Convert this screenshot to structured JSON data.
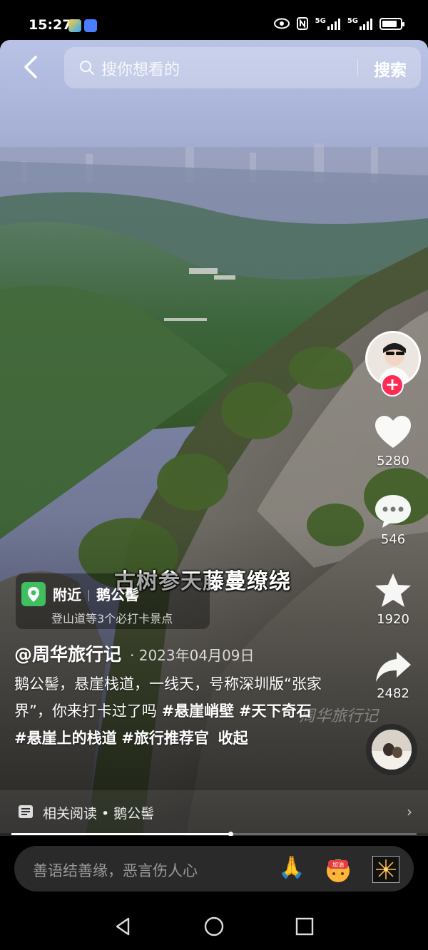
{
  "status_bar": {
    "time": "15:27",
    "network1": "5G",
    "network2": "5G",
    "battery_level": 0.85
  },
  "search": {
    "placeholder": "搜你想看的",
    "button_label": "搜索"
  },
  "video": {
    "subtitle": "古树参天藤蔓缭绕",
    "watermark": "周华旅行记"
  },
  "author": {
    "name": "@周华旅行记",
    "date": "· 2023年04月09日"
  },
  "location": {
    "label": "附近",
    "place": "鹅公髻",
    "subtitle": "登山道等3个必打卡景点"
  },
  "description": {
    "text": "鹅公髻，悬崖栈道，一线天，号称深圳版“张家界”，你来打卡过了吗 ",
    "tags": [
      "#悬崖峭壁",
      "#天下奇石",
      "#悬崖上的栈道",
      "#旅行推荐官"
    ],
    "collapse_label": "收起"
  },
  "actions": {
    "likes": "5280",
    "comments": "546",
    "favorites": "1920",
    "shares": "2482"
  },
  "related": {
    "label": "相关阅读 • 鹅公髻"
  },
  "playback": {
    "progress": 0.54
  },
  "comment_bar": {
    "placeholder": "善语结善缘，恶言伤人心",
    "quick_emoji_1": "🙏"
  },
  "icons": [
    "back-icon",
    "search-icon",
    "heart-icon",
    "comment-icon",
    "star-icon",
    "share-icon",
    "location-pin-icon",
    "related-read-icon",
    "chevron-right-icon",
    "pray-emoji-icon",
    "cheer-sticker-icon",
    "fireworks-icon",
    "nav-back-icon",
    "nav-home-icon",
    "nav-recents-icon"
  ],
  "colors": {
    "follow_plus": "#fe2c55",
    "location_pin": "#3fbf5e"
  }
}
